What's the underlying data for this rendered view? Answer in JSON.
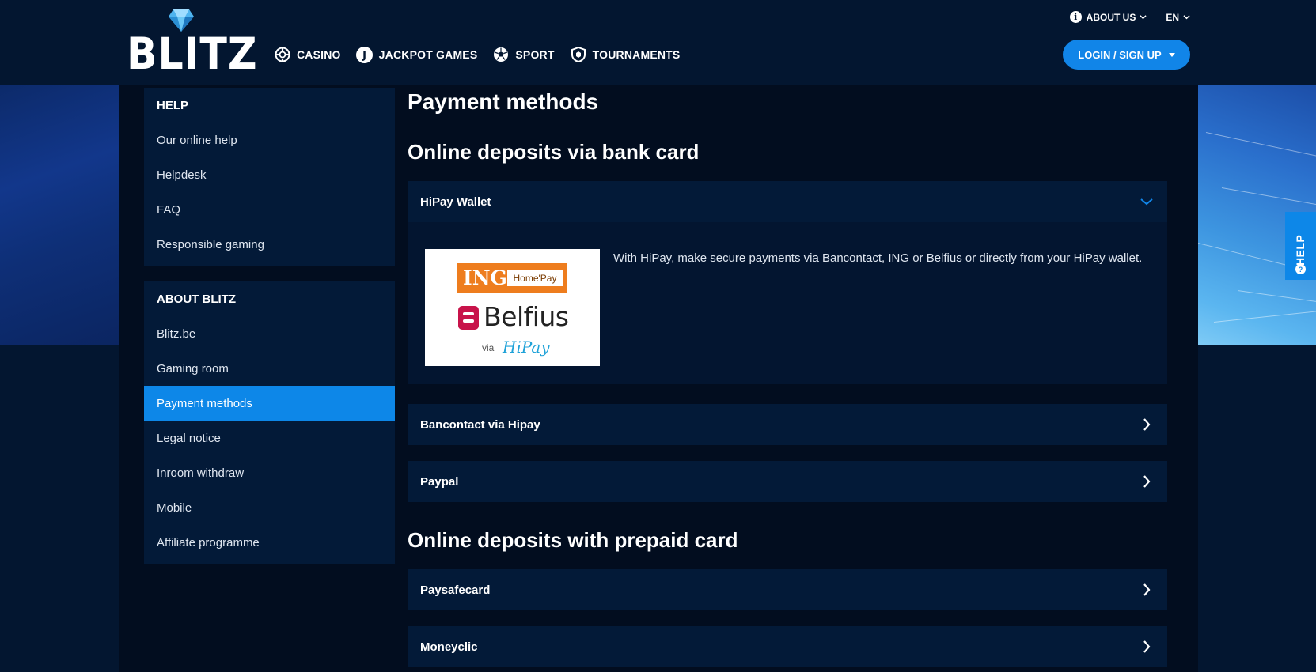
{
  "brand": {
    "logo_text": "BLITZ"
  },
  "nav": {
    "items": [
      {
        "label": "CASINO",
        "icon": "casino-chip-icon"
      },
      {
        "label": "JACKPOT GAMES",
        "icon": "jackpot-j-icon"
      },
      {
        "label": "SPORT",
        "icon": "soccer-ball-icon"
      },
      {
        "label": "TOURNAMENTS",
        "icon": "shield-badge-icon"
      }
    ]
  },
  "top_links": {
    "about_us": "ABOUT US",
    "language": "EN"
  },
  "login": {
    "label": "LOGIN / SIGN UP"
  },
  "sidebar": {
    "help": {
      "heading": "HELP",
      "items": [
        "Our online help",
        "Helpdesk",
        "FAQ",
        "Responsible gaming"
      ]
    },
    "about": {
      "heading": "ABOUT BLITZ",
      "items": [
        "Blitz.be",
        "Gaming room",
        "Payment methods",
        "Legal notice",
        "Inroom withdraw",
        "Mobile",
        "Affiliate programme"
      ],
      "active_index": 2
    }
  },
  "main": {
    "title": "Payment methods",
    "sections": [
      {
        "title": "Online deposits via bank card",
        "items": [
          {
            "label": "HiPay Wallet",
            "expanded": true,
            "description": "With HiPay, make secure payments via Bancontact, ING or Belfius or directly from your HiPay wallet.",
            "logo": {
              "ing": "ING",
              "homepay": "Home'Pay",
              "belfius": "Belfius",
              "via": "via",
              "hipay": "HiPay"
            }
          },
          {
            "label": "Bancontact via Hipay",
            "expanded": false
          },
          {
            "label": "Paypal",
            "expanded": false
          }
        ]
      },
      {
        "title": "Online deposits with prepaid card",
        "items": [
          {
            "label": "Paysafecard",
            "expanded": false
          },
          {
            "label": "Moneyclic",
            "expanded": false
          }
        ]
      }
    ]
  },
  "help_tab": {
    "label": "HELP"
  },
  "colors": {
    "background": "#031630",
    "panel": "#031a38",
    "accent": "#0d87e8",
    "ing_orange": "#ee7d1e",
    "belfius_red": "#c8134a",
    "hipay_blue": "#1fa2d8"
  }
}
